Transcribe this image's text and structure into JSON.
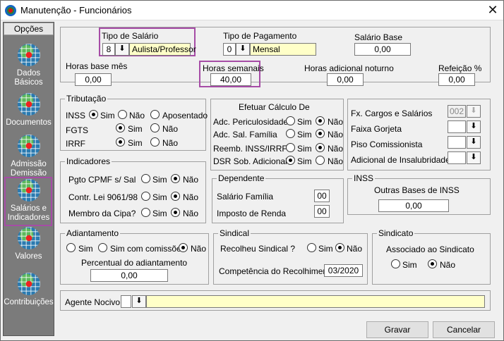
{
  "window": {
    "title": "Manutenção - Funcionários",
    "close": "✕"
  },
  "sidebar": {
    "header": "Opções",
    "items": [
      {
        "label1": "Dados",
        "label2": "Básicos"
      },
      {
        "label1": "Documentos",
        "label2": ""
      },
      {
        "label1": "Admissão",
        "label2": "Demissão"
      },
      {
        "label1": "Salários e",
        "label2": "Indicadores"
      },
      {
        "label1": "Valores",
        "label2": ""
      },
      {
        "label1": "Contribuições",
        "label2": ""
      }
    ]
  },
  "top": {
    "tipo_salario": {
      "label": "Tipo de Salário",
      "code": "8",
      "value": "Aulista/Professor"
    },
    "tipo_pagamento": {
      "label": "Tipo de Pagamento",
      "code": "0",
      "value": "Mensal"
    },
    "salario_base": {
      "label": "Salário Base",
      "value": "0,00"
    },
    "horas_base": {
      "label": "Horas base mês",
      "value": "0,00"
    },
    "horas_semanais": {
      "label": "Horas semanais",
      "value": "40,00"
    },
    "horas_noturno": {
      "label": "Horas adicional noturno",
      "value": "0,00"
    },
    "refeicao": {
      "label": "Refeição %",
      "value": "0,00"
    }
  },
  "tributacao": {
    "title": "Tributação",
    "rows": [
      {
        "label": "INSS",
        "opts": [
          "Sim",
          "Não",
          "Aposentado"
        ]
      },
      {
        "label": "FGTS",
        "opts": [
          "Sim",
          "Não"
        ]
      },
      {
        "label": "IRRF",
        "opts": [
          "Sim",
          "Não"
        ]
      }
    ]
  },
  "calculo": {
    "title": "Efetuar Cálculo De",
    "rows": [
      {
        "label": "Adc. Periculosidade",
        "opts": [
          "Sim",
          "Não"
        ]
      },
      {
        "label": "Adc. Sal. Família",
        "opts": [
          "Sim",
          "Não"
        ]
      },
      {
        "label": "Reemb. INSS/IRRF",
        "opts": [
          "Sim",
          "Não"
        ]
      },
      {
        "label": "DSR Sob. Adicionais",
        "opts": [
          "Sim",
          "Não"
        ]
      }
    ]
  },
  "faixas": {
    "rows": [
      {
        "label": "Fx. Cargos e Salários",
        "value": "002"
      },
      {
        "label": "Faixa Gorjeta",
        "value": ""
      },
      {
        "label": "Piso Comissionista",
        "value": ""
      },
      {
        "label": "Adicional de Insalubridade",
        "value": ""
      }
    ]
  },
  "indicadores": {
    "title": "Indicadores",
    "rows": [
      {
        "label": "Pgto CPMF s/ Sal",
        "opts": [
          "Sim",
          "Não"
        ]
      },
      {
        "label": "Contr. Lei 9061/98",
        "opts": [
          "Sim",
          "Não"
        ]
      },
      {
        "label": "Membro da Cipa?",
        "opts": [
          "Sim",
          "Não"
        ]
      }
    ]
  },
  "dependente": {
    "title": "Dependente",
    "salario_familia": {
      "label": "Salário Família",
      "value": "00"
    },
    "imposto_renda": {
      "label": "Imposto de Renda",
      "value": "00"
    }
  },
  "inss": {
    "title": "INSS",
    "outras_bases": {
      "label": "Outras Bases de INSS",
      "value": "0,00"
    }
  },
  "adiantamento": {
    "title": "Adiantamento",
    "opts": [
      "Sim",
      "Sim com comissões",
      "Não"
    ],
    "percentual": {
      "label": "Percentual do adiantamento",
      "value": "0,00"
    }
  },
  "sindical": {
    "title": "Sindical",
    "recolheu": {
      "label": "Recolheu Sindical ?",
      "opts": [
        "Sim",
        "Não"
      ]
    },
    "competencia": {
      "label": "Competência do Recolhimento",
      "value": "03/2020"
    }
  },
  "sindicato": {
    "title": "Sindicato",
    "associado": {
      "label": "Associado ao Sindicato",
      "opts": [
        "Sim",
        "Não"
      ]
    }
  },
  "agente": {
    "label": "Agente Nocivo",
    "code": "",
    "value": ""
  },
  "buttons": {
    "save": "Gravar",
    "cancel": "Cancelar"
  },
  "colors": {
    "highlight": "#a64ca6",
    "yellow_field": "#ffffc8",
    "sidebar_bg": "#7b7b7b"
  }
}
